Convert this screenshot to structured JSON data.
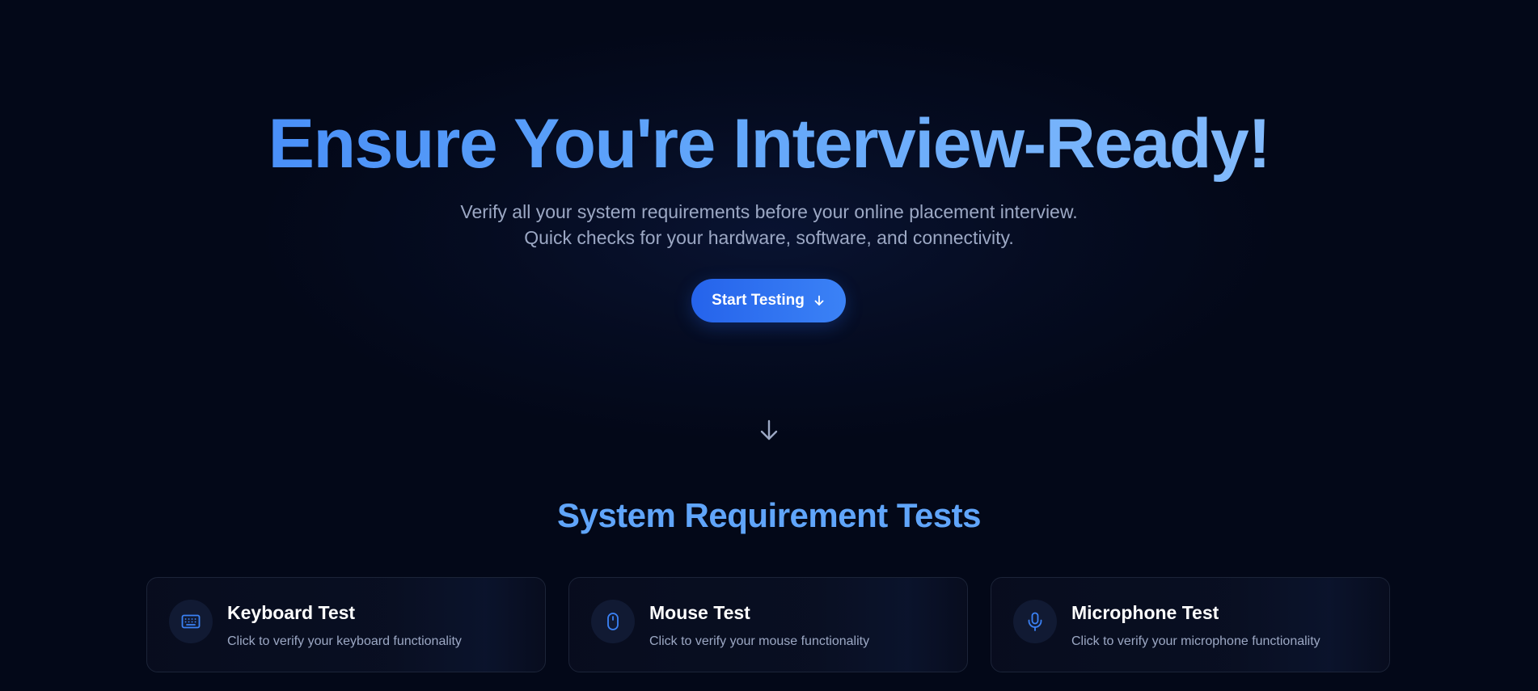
{
  "hero": {
    "title": "Ensure You're Interview-Ready!",
    "subtitle": "Verify all your system requirements before your online placement interview. Quick checks for your hardware, software, and connectivity.",
    "cta_label": "Start Testing",
    "cta_icon": "arrow-down-icon",
    "scroll_icon": "arrow-down-icon"
  },
  "section": {
    "title": "System Requirement Tests"
  },
  "cards": [
    {
      "title": "Keyboard Test",
      "description": "Click to verify your keyboard functionality",
      "icon": "keyboard-icon"
    },
    {
      "title": "Mouse Test",
      "description": "Click to verify your mouse functionality",
      "icon": "mouse-icon"
    },
    {
      "title": "Microphone Test",
      "description": "Click to verify your microphone functionality",
      "icon": "microphone-icon"
    }
  ],
  "colors": {
    "background": "#030818",
    "accent": "#3b82f6",
    "accent_light": "#60a5fa",
    "muted_text": "#9ca8c4",
    "card_border": "#1c2438"
  }
}
